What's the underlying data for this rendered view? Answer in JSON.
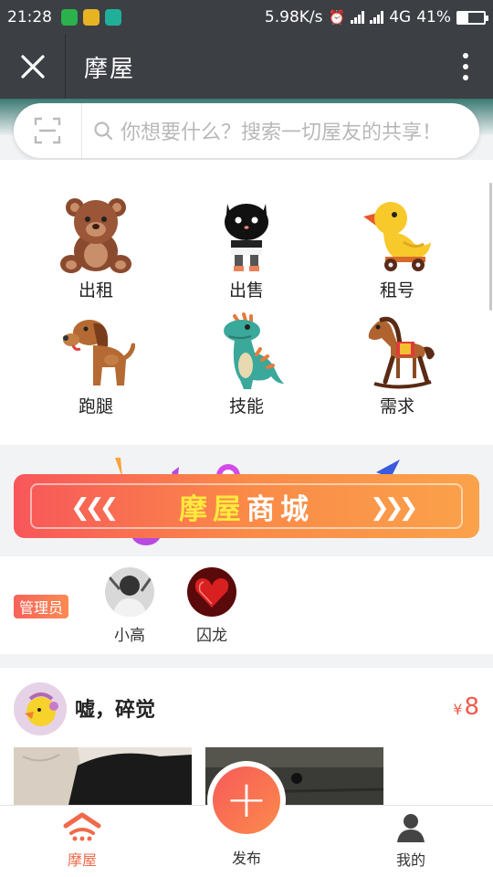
{
  "status_bar": {
    "time": "21:28",
    "speed": "5.98K/s",
    "network": "4G",
    "battery": "41%",
    "battery_level": 0.41
  },
  "header": {
    "title": "摩屋"
  },
  "search": {
    "placeholder": "你想要什么？搜索一切屋友的共享！"
  },
  "categories": [
    {
      "label": "出租",
      "icon": "teddy-bear-icon"
    },
    {
      "label": "出售",
      "icon": "black-cat-icon"
    },
    {
      "label": "租号",
      "icon": "rubber-duck-icon"
    },
    {
      "label": "跑腿",
      "icon": "dog-icon"
    },
    {
      "label": "技能",
      "icon": "dinosaur-icon"
    },
    {
      "label": "需求",
      "icon": "rocking-horse-icon"
    }
  ],
  "banner": {
    "part1": "摩屋",
    "part2": "商城"
  },
  "admins": {
    "badge": "管理员",
    "members": [
      {
        "name": "小高"
      },
      {
        "name": "囚龙"
      }
    ]
  },
  "post": {
    "title": "嘘，碎觉",
    "currency": "¥",
    "price": "8"
  },
  "tabbar": {
    "items": [
      {
        "label": "摩屋"
      },
      {
        "label": "发布"
      },
      {
        "label": "我的"
      }
    ],
    "active_color": "#f06a4a",
    "inactive_color": "#333333"
  }
}
